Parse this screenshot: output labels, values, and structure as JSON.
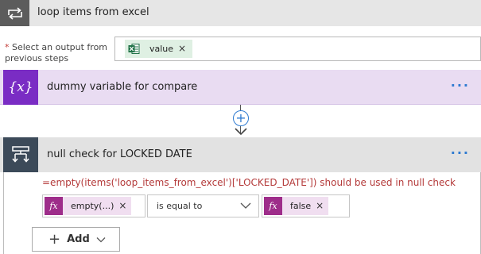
{
  "loop": {
    "title": "loop items from excel",
    "icon": "loop-icon"
  },
  "select_output": {
    "required_marker": "*",
    "label": "Select an output from previous steps",
    "token": {
      "label": "value",
      "close": "×",
      "icon": "excel-icon"
    }
  },
  "variable_action": {
    "title": "dummy variable for compare",
    "icon_text": "{x}",
    "more": "···"
  },
  "connector": {
    "add_symbol": "+"
  },
  "condition": {
    "title": "null check for LOCKED DATE",
    "more": "···",
    "hint": "=empty(items('loop_items_from_excel')['LOCKED_DATE']) should be used in null check",
    "left_operand": {
      "fx": "fx",
      "label": "empty(...)",
      "close": "×"
    },
    "operator": "is equal to",
    "right_operand": {
      "fx": "fx",
      "label": "false",
      "close": "×"
    },
    "add_button": {
      "plus": "+",
      "label": "Add"
    }
  },
  "colors": {
    "accent": "#2f7bd1",
    "variable": "#7a2cc4",
    "function": "#9e2d8a",
    "excel": "#1e7145",
    "hint": "#b43a3a"
  }
}
